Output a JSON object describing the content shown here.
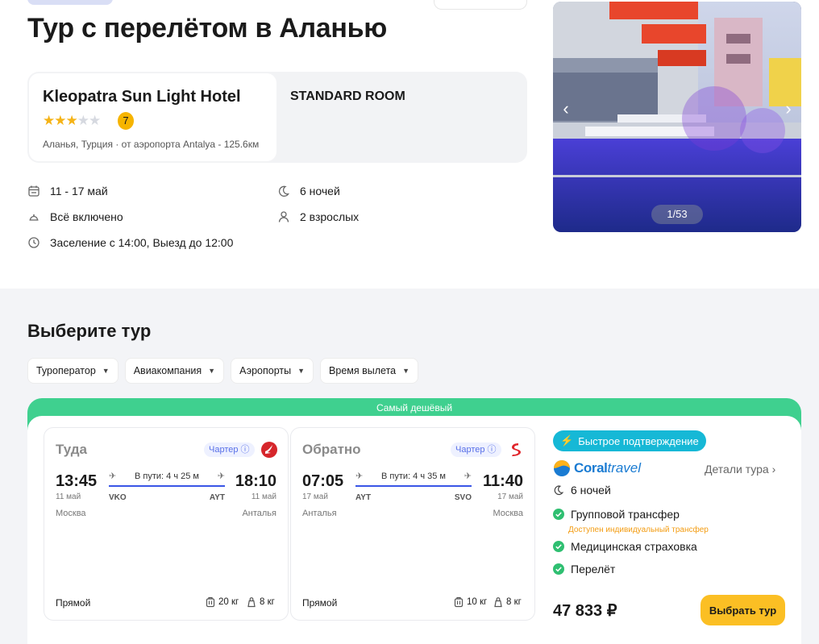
{
  "header": {
    "title": "Тур с перелётом в Аланью"
  },
  "hotel": {
    "name": "Kleopatra Sun Light Hotel",
    "stars": 3,
    "rating": "7",
    "location": "Аланья, Турция",
    "airport_distance": "· от аэропорта Antalya - 125.6км",
    "room": "STANDARD ROOM"
  },
  "facts": {
    "dates": "11 - 17 май",
    "nights": "6 ночей",
    "meal": "Всё включено",
    "guests": "2 взрослых",
    "checkin": "Заселение с 14:00, Выезд до 12:00"
  },
  "gallery": {
    "counter": "1/53"
  },
  "select_section": {
    "title": "Выберите тур",
    "filters": [
      "Туроператор",
      "Авиакомпания",
      "Аэропорты",
      "Время вылета"
    ]
  },
  "offer": {
    "badge": "Самый дешёвый",
    "outbound": {
      "label": "Туда",
      "charter": "Чартер",
      "dep_time": "13:45",
      "arr_time": "18:10",
      "dep_date": "11 май",
      "arr_date": "11 май",
      "dep_code": "VKO",
      "arr_code": "AYT",
      "dep_city": "Москва",
      "arr_city": "Анталья",
      "duration": "В пути: 4 ч 25 м",
      "type": "Прямой",
      "bag": "20 кг",
      "hand": "8 кг"
    },
    "inbound": {
      "label": "Обратно",
      "charter": "Чартер",
      "dep_time": "07:05",
      "arr_time": "11:40",
      "dep_date": "17 май",
      "arr_date": "17 май",
      "dep_code": "AYT",
      "arr_code": "SVO",
      "dep_city": "Анталья",
      "arr_city": "Москва",
      "duration": "В пути: 4 ч 35 м",
      "type": "Прямой",
      "bag": "10 кг",
      "hand": "8 кг"
    },
    "fast_confirm": "Быстрое подтверждение",
    "operator_a": "Coral",
    "operator_b": "travel",
    "details": "Детали тура",
    "nights": "6 ночей",
    "transfer": "Групповой трансфер",
    "transfer_note": "Доступен индивидуальный трансфер",
    "insurance": "Медицинская страховка",
    "flight": "Перелёт",
    "price": "47 833 ₽",
    "select": "Выбрать тур"
  },
  "colors": {
    "accent_green": "#3fd08f",
    "accent_yellow": "#fbbf24",
    "accent_blue": "#3a55e6",
    "fast_badge": "#16b8d6"
  }
}
